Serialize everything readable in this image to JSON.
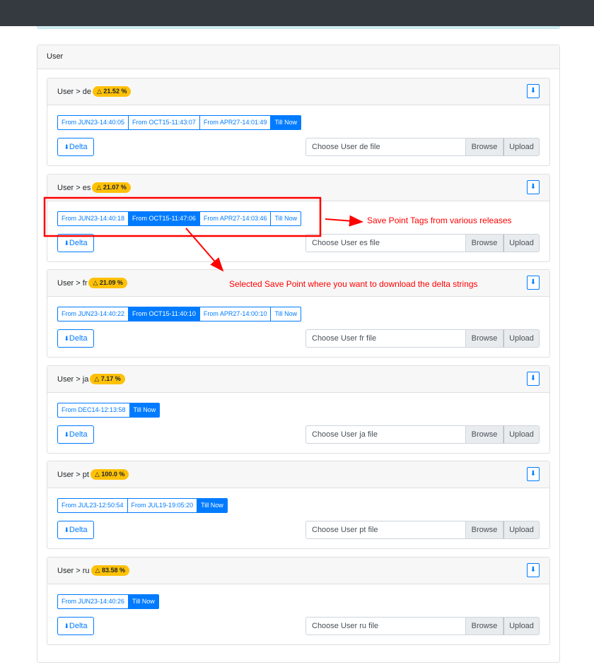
{
  "section": {
    "title": "User"
  },
  "locales": [
    {
      "title": "User > de",
      "badge": "△ 21.52 %",
      "tags": [
        "From JUN23-14:40:05",
        "From OCT15-11:43:07",
        "From APR27-14:01:49",
        "Till Now"
      ],
      "active": 3,
      "delta": "Delta",
      "file_placeholder": "Choose User de file",
      "browse": "Browse",
      "upload": "Upload"
    },
    {
      "title": "User > es",
      "badge": "△ 21.07 %",
      "tags": [
        "From JUN23-14:40:18",
        "From OCT15-11:47:06",
        "From APR27-14:03:46",
        "Till Now"
      ],
      "active": 1,
      "delta": "Delta",
      "file_placeholder": "Choose User es file",
      "browse": "Browse",
      "upload": "Upload"
    },
    {
      "title": "User > fr",
      "badge": "△ 21.09 %",
      "tags": [
        "From JUN23-14:40:22",
        "From OCT15-11:40:10",
        "From APR27-14:00:10",
        "Till Now"
      ],
      "active": 1,
      "delta": "Delta",
      "file_placeholder": "Choose User fr file",
      "browse": "Browse",
      "upload": "Upload"
    },
    {
      "title": "User > ja",
      "badge": "△ 7.17 %",
      "tags": [
        "From DEC14-12:13:58",
        "Till Now"
      ],
      "active": 1,
      "delta": "Delta",
      "file_placeholder": "Choose User ja file",
      "browse": "Browse",
      "upload": "Upload"
    },
    {
      "title": "User > pt",
      "badge": "△ 100.0 %",
      "tags": [
        "From JUL23-12:50:54",
        "From JUL19-19:05:20",
        "Till Now"
      ],
      "active": 2,
      "delta": "Delta",
      "file_placeholder": "Choose User pt file",
      "browse": "Browse",
      "upload": "Upload"
    },
    {
      "title": "User > ru",
      "badge": "△ 83.58 %",
      "tags": [
        "From JUN23-14:40:26",
        "Till Now"
      ],
      "active": 1,
      "delta": "Delta",
      "file_placeholder": "Choose User ru file",
      "browse": "Browse",
      "upload": "Upload"
    }
  ],
  "icons": {
    "download": "download-icon"
  },
  "annotations": {
    "tags_note": "Save Point Tags from various releases",
    "selected_note": "Selected Save Point where you want to download the delta strings",
    "color": "#ff0000"
  }
}
